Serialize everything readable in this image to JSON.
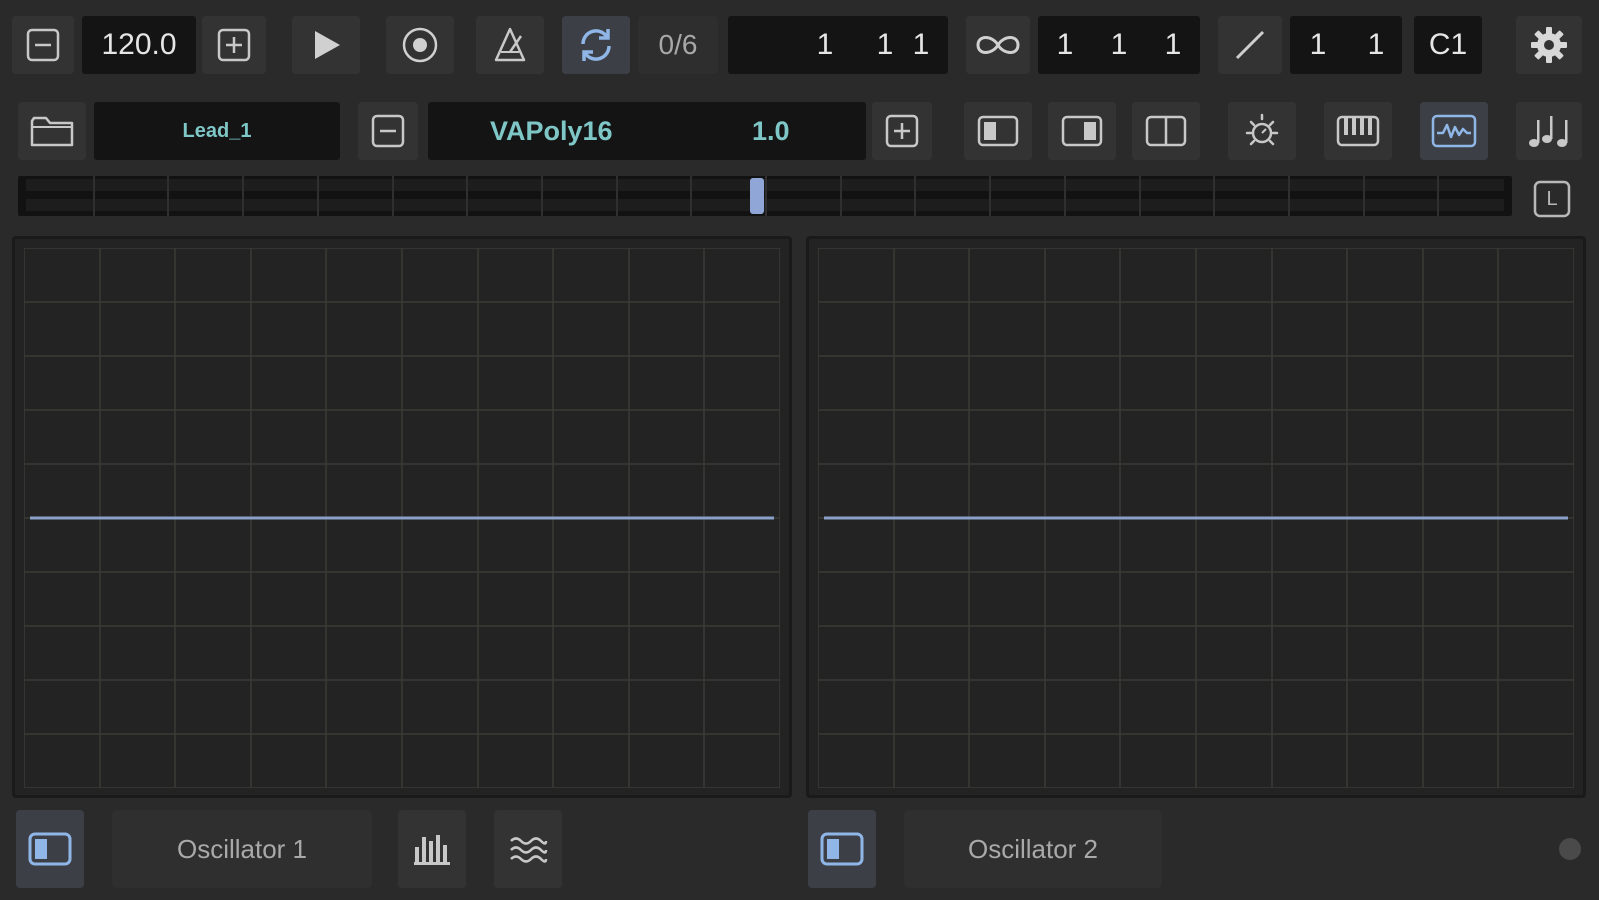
{
  "transport": {
    "tempo": "120.0",
    "counter": "0/6",
    "position": {
      "bar": "1",
      "beat": "1",
      "tick": "1"
    },
    "loop_length": {
      "bar": "1",
      "beat": "1",
      "tick": "1"
    },
    "quantize": {
      "a": "1",
      "b": "1"
    },
    "root_note": "C1"
  },
  "instrument": {
    "preset_name": "Lead_1",
    "synth_name": "VAPoly16",
    "version": "1.0"
  },
  "strip": {
    "lock_label": "L",
    "scroll_position": 0.49
  },
  "footer": {
    "osc1_label": "Oscillator 1",
    "osc2_label": "Oscillator 2"
  },
  "colors": {
    "background": "#2a2a2a",
    "display": "#141414",
    "accent": "#8fa6d6",
    "teal_text": "#7fc7c7",
    "waveform": "#8aa0c8",
    "grid": "#3a3a36"
  },
  "icons": [
    "minus-icon",
    "plus-icon",
    "play-icon",
    "record-icon",
    "metronome-icon",
    "loop-icon",
    "infinity-icon",
    "pencil-icon",
    "gear-icon",
    "folder-icon",
    "panel-left-icon",
    "panel-right-icon",
    "panel-split-icon",
    "brightness-icon",
    "keyboard-icon",
    "waveform-icon",
    "notes-icon",
    "lock-icon",
    "spectrum-icon",
    "waves-icon"
  ]
}
